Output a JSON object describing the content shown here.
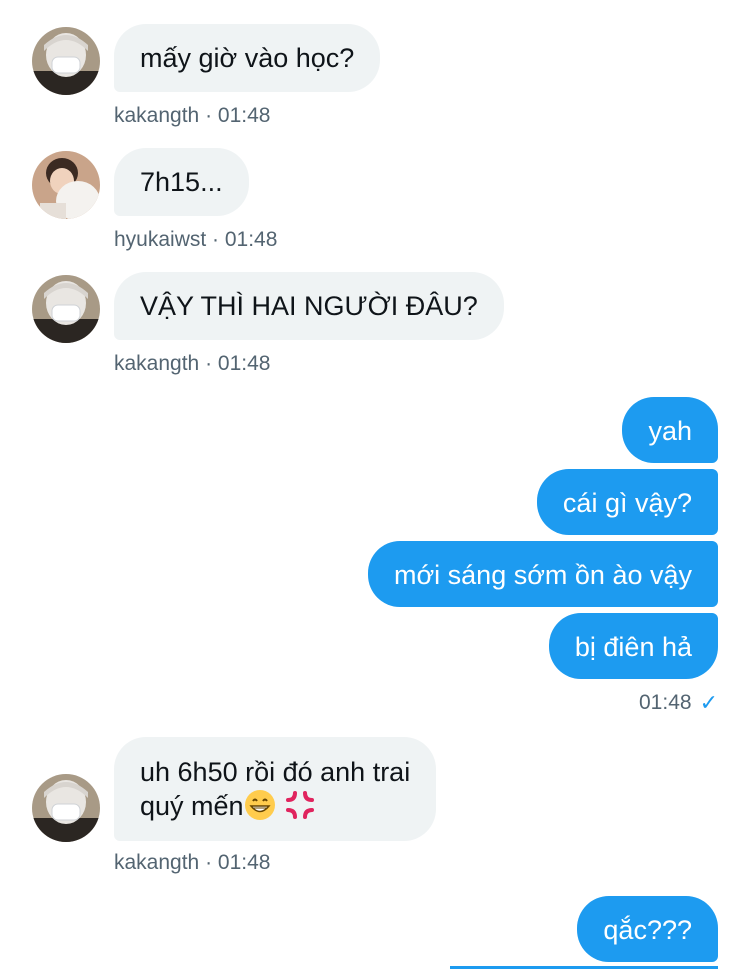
{
  "messages": [
    {
      "sender": "kakangth",
      "text": "mấy giờ vào học?",
      "meta": "kakangth · 01:48"
    },
    {
      "sender": "hyukaiwst",
      "text": "7h15...",
      "meta": "hyukaiwst · 01:48"
    },
    {
      "sender": "kakangth",
      "text": "VẬY THÌ HAI NGƯỜI ĐÂU?",
      "meta": "kakangth · 01:48"
    },
    {
      "sender": "me",
      "text": "yah"
    },
    {
      "sender": "me",
      "text": "cái gì vậy?"
    },
    {
      "sender": "me",
      "text": "mới sáng sớm ồn ào vậy"
    },
    {
      "sender": "me",
      "text": "bị điên hả",
      "meta": "01:48"
    },
    {
      "sender": "kakangth",
      "line1": "uh 6h50 rồi đó anh trai",
      "line2": "quý mến",
      "meta": "kakangth · 01:48"
    },
    {
      "sender": "me",
      "text": "qắc???"
    }
  ],
  "icons": {
    "read_receipt": "checkmark-icon",
    "emoji_grin": "grinning-face-emoji",
    "emoji_anger": "anger-symbol-emoji"
  },
  "colors": {
    "incoming_bubble": "#eff3f4",
    "outgoing_bubble": "#1d9bf0",
    "meta_text": "#536471"
  }
}
